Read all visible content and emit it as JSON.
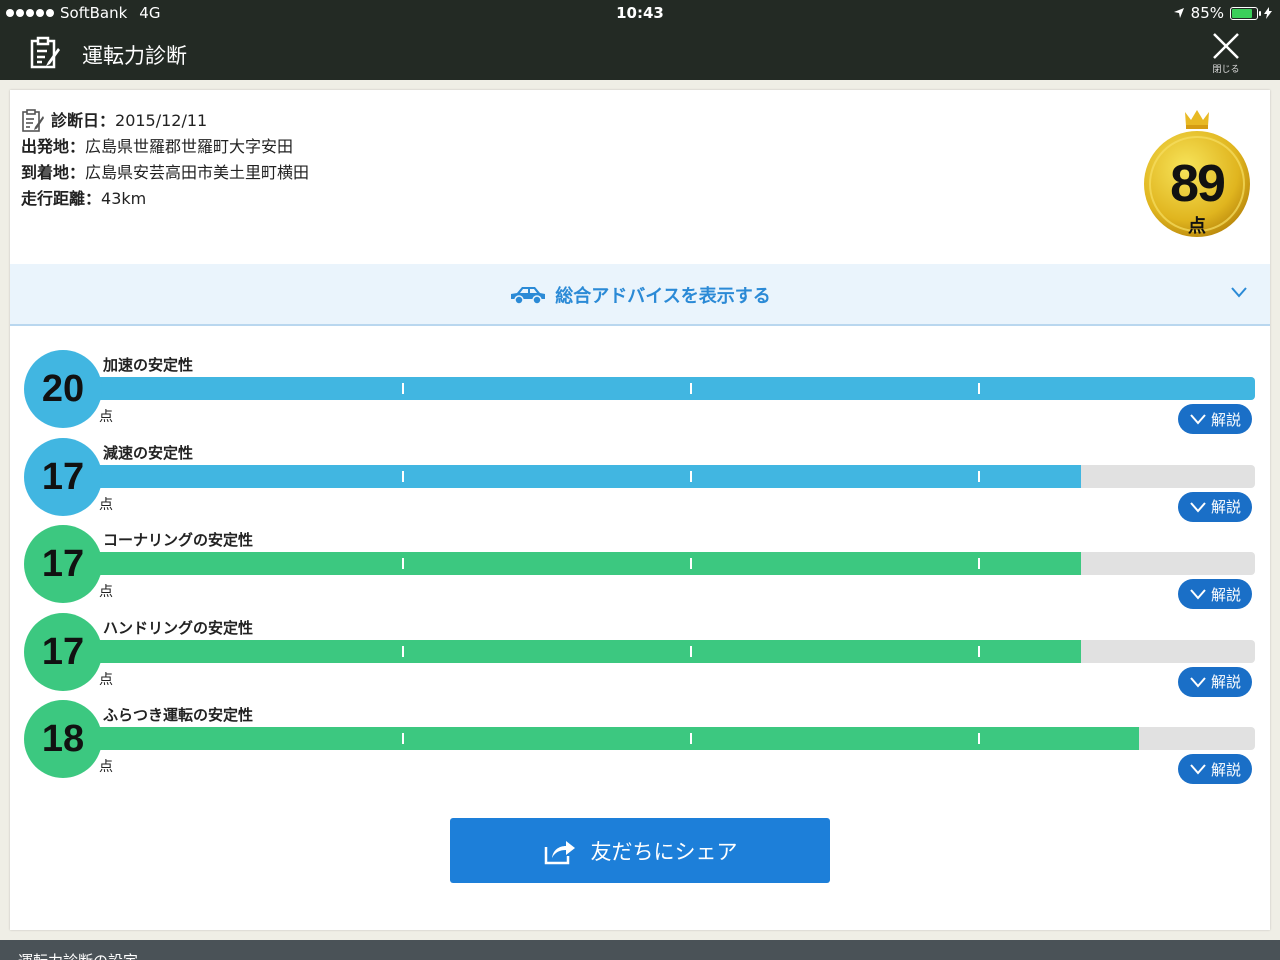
{
  "status_bar": {
    "carrier": "SoftBank",
    "network": "4G",
    "time": "10:43",
    "battery": "85%",
    "battery_level": 0.85,
    "battery_color": "#3bd05a"
  },
  "nav": {
    "title": "運転力診断",
    "close_label": "閉じる",
    "icon": "memo-icon"
  },
  "info": {
    "date_label": "診断日：",
    "date": "2015/12/11",
    "departure_label": "出発地：",
    "departure": "広島県世羅郡世羅町大字安田",
    "arrival_label": "到着地：",
    "arrival": "広島県安芸高田市美土里町横田",
    "distance_label": "走行距離：",
    "distance": "43km"
  },
  "total_score": {
    "value": "89",
    "unit": "点",
    "icon": "crown-icon"
  },
  "advice": {
    "label": "総合アドバイスを表示する",
    "icon": "car-icon"
  },
  "metrics": [
    {
      "score": "20",
      "max": 20,
      "label": "加速の安定性",
      "unit": "点",
      "button": "解説",
      "color": "#41b6e1"
    },
    {
      "score": "17",
      "max": 20,
      "label": "減速の安定性",
      "unit": "点",
      "button": "解説",
      "color": "#41b6e1"
    },
    {
      "score": "17",
      "max": 20,
      "label": "コーナリングの安定性",
      "unit": "点",
      "button": "解説",
      "color": "#3cc880"
    },
    {
      "score": "17",
      "max": 20,
      "label": "ハンドリングの安定性",
      "unit": "点",
      "button": "解説",
      "color": "#3cc880"
    },
    {
      "score": "18",
      "max": 20,
      "label": "ふらつき運転の安定性",
      "unit": "点",
      "button": "解説",
      "color": "#3cc880"
    }
  ],
  "share": {
    "label": "友だちにシェア",
    "icon": "share-icon"
  },
  "footer": {
    "label": "運転力診断の設定"
  },
  "colors": {
    "nav_bg": "#232a24",
    "accent_blue": "#1d7fd9",
    "advice_text": "#2b8ad6"
  }
}
